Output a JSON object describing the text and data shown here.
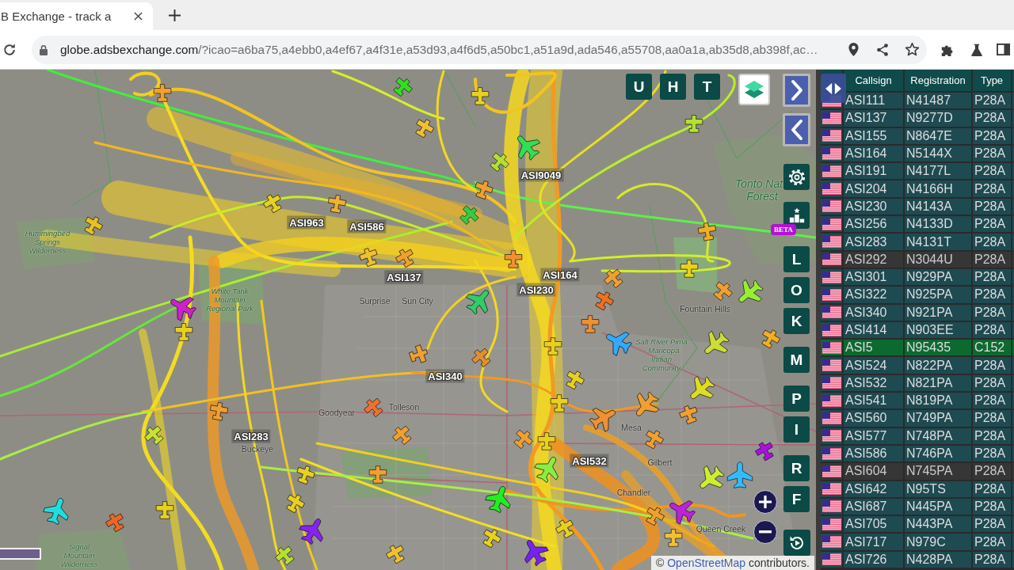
{
  "browser": {
    "tab": {
      "title": "B Exchange - track a"
    },
    "url": {
      "host": "globe.adsbexchange.com",
      "path": "/?icao=a6ba75,a4ebb0,a4ef67,a4f31e,a53d93,a4f6d5,a50bc1,a51a9d,ada546,a55708,aa0a1a,ab35d8,ab398f,ac…"
    }
  },
  "map": {
    "place_labels": [
      {
        "text": "Tonto Nat",
        "kind": "region"
      },
      {
        "text": "Forest",
        "kind": "region"
      },
      {
        "text": "Hummingbird Springs Wilderness",
        "kind": "area"
      },
      {
        "text": "White Tank Mountain Regional Park",
        "kind": "area"
      },
      {
        "text": "Surprise",
        "kind": "city"
      },
      {
        "text": "Sun City",
        "kind": "city"
      },
      {
        "text": "Fountain Hills",
        "kind": "city"
      },
      {
        "text": "Salt River Pima - Maricopa Indian Community",
        "kind": "area"
      },
      {
        "text": "Tolleson",
        "kind": "city"
      },
      {
        "text": "Goodyear",
        "kind": "city"
      },
      {
        "text": "Mesa",
        "kind": "city"
      },
      {
        "text": "Buckeye",
        "kind": "city"
      },
      {
        "text": "Gilbert",
        "kind": "city"
      },
      {
        "text": "Chandler",
        "kind": "city"
      },
      {
        "text": "Queen Creek",
        "kind": "city"
      },
      {
        "text": "Signal Mountain Wilderness",
        "kind": "area"
      }
    ],
    "aircraft": [
      {
        "kind": "prop",
        "color": "#33dd22"
      },
      {
        "kind": "prop",
        "color": "#e6d21e"
      },
      {
        "kind": "prop",
        "color": "#f0c030"
      },
      {
        "kind": "jet",
        "color": "#33dd55"
      },
      {
        "kind": "prop",
        "color": "#b4e030"
      },
      {
        "kind": "prop",
        "color": "#f0a030"
      },
      {
        "kind": "prop",
        "color": "#33cc44"
      },
      {
        "kind": "prop",
        "color": "#e8d020"
      },
      {
        "kind": "prop",
        "color": "#f0b030"
      },
      {
        "kind": "prop",
        "color": "#e8c020"
      },
      {
        "kind": "prop",
        "color": "#f0c030"
      },
      {
        "kind": "prop",
        "color": "#f0a030"
      },
      {
        "kind": "prop",
        "color": "#f09030"
      },
      {
        "kind": "jet",
        "color": "#33cc66"
      },
      {
        "kind": "jet",
        "color": "#cc22cc"
      },
      {
        "kind": "prop",
        "color": "#e8d020"
      },
      {
        "kind": "prop",
        "color": "#f0a030"
      },
      {
        "kind": "prop",
        "color": "#f07020"
      },
      {
        "kind": "prop",
        "color": "#f09030"
      },
      {
        "kind": "jet",
        "color": "#33aaff"
      },
      {
        "kind": "prop",
        "color": "#e8d020"
      },
      {
        "kind": "prop",
        "color": "#f0a030"
      },
      {
        "kind": "prop",
        "color": "#e09030"
      },
      {
        "kind": "prop",
        "color": "#b4e030"
      },
      {
        "kind": "prop",
        "color": "#f0b020"
      },
      {
        "kind": "prop",
        "color": "#e8d020"
      },
      {
        "kind": "prop",
        "color": "#f0a030"
      },
      {
        "kind": "jet",
        "color": "#99ee33"
      },
      {
        "kind": "jet",
        "color": "#ccdd33"
      },
      {
        "kind": "prop",
        "color": "#f0b020"
      },
      {
        "kind": "jet",
        "color": "#dddd22"
      },
      {
        "kind": "prop",
        "color": "#f0a030"
      },
      {
        "kind": "jet",
        "color": "#f0a030"
      },
      {
        "kind": "jet",
        "color": "#f09030"
      },
      {
        "kind": "prop",
        "color": "#e8d020"
      },
      {
        "kind": "prop",
        "color": "#e8d020"
      },
      {
        "kind": "prop",
        "color": "#e8d020"
      },
      {
        "kind": "prop",
        "color": "#f0a030"
      },
      {
        "kind": "jet",
        "color": "#88ee44"
      },
      {
        "kind": "prop",
        "color": "#f0a030"
      },
      {
        "kind": "prop",
        "color": "#aa11dd"
      },
      {
        "kind": "jet",
        "color": "#ccee33"
      },
      {
        "kind": "jet",
        "color": "#33bbff"
      },
      {
        "kind": "jet",
        "color": "#22ee22"
      },
      {
        "kind": "jet",
        "color": "#bb22dd"
      },
      {
        "kind": "prop",
        "color": "#f0a030"
      },
      {
        "kind": "jet",
        "color": "#22dddd"
      },
      {
        "kind": "prop",
        "color": "#ee6622"
      },
      {
        "kind": "prop",
        "color": "#e8d020"
      },
      {
        "kind": "prop",
        "color": "#f0a030"
      },
      {
        "kind": "prop",
        "color": "#c8e030"
      },
      {
        "kind": "prop",
        "color": "#e8d020"
      },
      {
        "kind": "prop",
        "color": "#f0a030"
      },
      {
        "kind": "prop",
        "color": "#f07030"
      },
      {
        "kind": "prop",
        "color": "#f0a030"
      },
      {
        "kind": "jet",
        "color": "#8822ee"
      },
      {
        "kind": "prop",
        "color": "#e8d020"
      },
      {
        "kind": "prop",
        "color": "#b4e030"
      },
      {
        "kind": "prop",
        "color": "#f0c030"
      },
      {
        "kind": "jet",
        "color": "#7722ee"
      },
      {
        "kind": "prop",
        "color": "#e8d020"
      },
      {
        "kind": "prop",
        "color": "#e8d020"
      },
      {
        "kind": "prop",
        "color": "#f0a030"
      },
      {
        "kind": "prop",
        "color": "#f0c030"
      }
    ],
    "aircraft_labels": [
      "ASI9049",
      "ASI963",
      "ASI586",
      "ASI164",
      "ASI137",
      "ASI230",
      "ASI340",
      "ASI283",
      "ASI532"
    ],
    "top_buttons": [
      "U",
      "H",
      "T"
    ],
    "side_button_groups": [
      [
        "L",
        "O",
        "K"
      ],
      [
        "M"
      ],
      [
        "P",
        "I"
      ],
      [
        "R",
        "F"
      ]
    ],
    "stats_badge": "BETA",
    "attribution": {
      "prefix": "©",
      "link": "OpenStreetMap",
      "suffix": "contributors."
    }
  },
  "table": {
    "columns": [
      "Callsign",
      "Registration",
      "Type"
    ],
    "rows": [
      {
        "callsign": "ASI111",
        "registration": "N41487",
        "type": "P28A",
        "selected": false,
        "inactive": false
      },
      {
        "callsign": "ASI137",
        "registration": "N9277D",
        "type": "P28A",
        "selected": false,
        "inactive": false
      },
      {
        "callsign": "ASI155",
        "registration": "N8647E",
        "type": "P28A",
        "selected": false,
        "inactive": false
      },
      {
        "callsign": "ASI164",
        "registration": "N5144X",
        "type": "P28A",
        "selected": false,
        "inactive": false
      },
      {
        "callsign": "ASI191",
        "registration": "N4177L",
        "type": "P28A",
        "selected": false,
        "inactive": false
      },
      {
        "callsign": "ASI204",
        "registration": "N4166H",
        "type": "P28A",
        "selected": false,
        "inactive": false
      },
      {
        "callsign": "ASI230",
        "registration": "N4143A",
        "type": "P28A",
        "selected": false,
        "inactive": false
      },
      {
        "callsign": "ASI256",
        "registration": "N4133D",
        "type": "P28A",
        "selected": false,
        "inactive": false
      },
      {
        "callsign": "ASI283",
        "registration": "N4131T",
        "type": "P28A",
        "selected": false,
        "inactive": false
      },
      {
        "callsign": "ASI292",
        "registration": "N3044U",
        "type": "P28A",
        "selected": false,
        "inactive": true
      },
      {
        "callsign": "ASI301",
        "registration": "N929PA",
        "type": "P28A",
        "selected": false,
        "inactive": false
      },
      {
        "callsign": "ASI322",
        "registration": "N925PA",
        "type": "P28A",
        "selected": false,
        "inactive": false
      },
      {
        "callsign": "ASI340",
        "registration": "N921PA",
        "type": "P28A",
        "selected": false,
        "inactive": false
      },
      {
        "callsign": "ASI414",
        "registration": "N903EE",
        "type": "P28A",
        "selected": false,
        "inactive": false
      },
      {
        "callsign": "ASI5",
        "registration": "N95435",
        "type": "C152",
        "selected": true,
        "inactive": false
      },
      {
        "callsign": "ASI524",
        "registration": "N822PA",
        "type": "P28A",
        "selected": false,
        "inactive": false
      },
      {
        "callsign": "ASI532",
        "registration": "N821PA",
        "type": "P28A",
        "selected": false,
        "inactive": false
      },
      {
        "callsign": "ASI541",
        "registration": "N819PA",
        "type": "P28A",
        "selected": false,
        "inactive": false
      },
      {
        "callsign": "ASI560",
        "registration": "N749PA",
        "type": "P28A",
        "selected": false,
        "inactive": false
      },
      {
        "callsign": "ASI577",
        "registration": "N748PA",
        "type": "P28A",
        "selected": false,
        "inactive": false
      },
      {
        "callsign": "ASI586",
        "registration": "N746PA",
        "type": "P28A",
        "selected": false,
        "inactive": false
      },
      {
        "callsign": "ASI604",
        "registration": "N745PA",
        "type": "P28A",
        "selected": false,
        "inactive": true
      },
      {
        "callsign": "ASI642",
        "registration": "N95TS",
        "type": "P28A",
        "selected": false,
        "inactive": false
      },
      {
        "callsign": "ASI687",
        "registration": "N445PA",
        "type": "P28A",
        "selected": false,
        "inactive": false
      },
      {
        "callsign": "ASI705",
        "registration": "N443PA",
        "type": "P28A",
        "selected": false,
        "inactive": false
      },
      {
        "callsign": "ASI717",
        "registration": "N979C",
        "type": "P28A",
        "selected": false,
        "inactive": false
      },
      {
        "callsign": "ASI726",
        "registration": "N428PA",
        "type": "P28A",
        "selected": false,
        "inactive": false
      }
    ]
  }
}
